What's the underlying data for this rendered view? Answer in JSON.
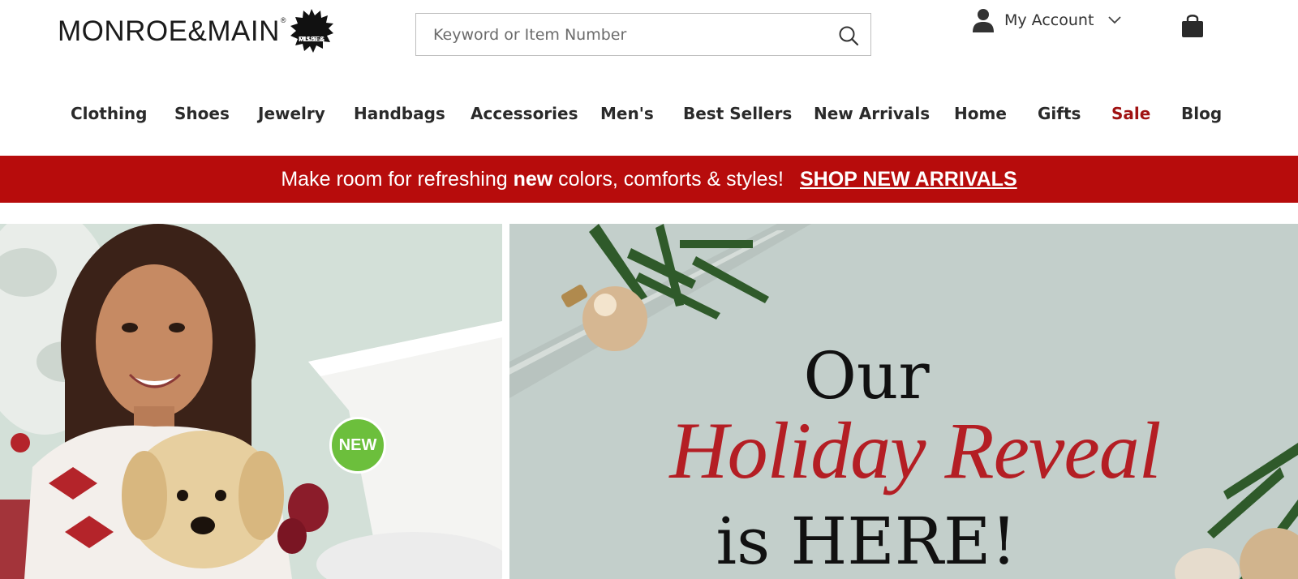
{
  "header": {
    "logo_text_bold": "MONROE",
    "logo_text_amp": "&",
    "logo_text_light": "MAIN",
    "logo_reg": "®",
    "logo_badge_line1": "PLUS &",
    "logo_badge_line2": "MISSES",
    "search_placeholder": "Keyword or Item Number",
    "account_label": "My Account"
  },
  "nav": {
    "items": [
      "Clothing",
      "Shoes",
      "Jewelry",
      "Handbags",
      "Accessories",
      "Men's",
      "Best Sellers",
      "New Arrivals",
      "Home",
      "Gifts",
      "Sale",
      "Blog"
    ],
    "sale_color": "#a01212"
  },
  "promo": {
    "message_pre": "Make room for refreshing ",
    "message_bold": "new",
    "message_post": " colors, comforts & styles!",
    "cta": "SHOP NEW ARRIVALS",
    "background": "#b70c0c"
  },
  "hero": {
    "left_badge": "NEW",
    "badge_color": "#6cbf3c",
    "right_line1": "Our",
    "right_line2": "Holiday Reveal",
    "right_line3": "is HERE!",
    "accent_red": "#b41e24"
  },
  "icons": {
    "search": "search-icon",
    "account": "user-icon",
    "dropdown": "chevron-down-icon",
    "cart": "shopping-bag-icon"
  }
}
